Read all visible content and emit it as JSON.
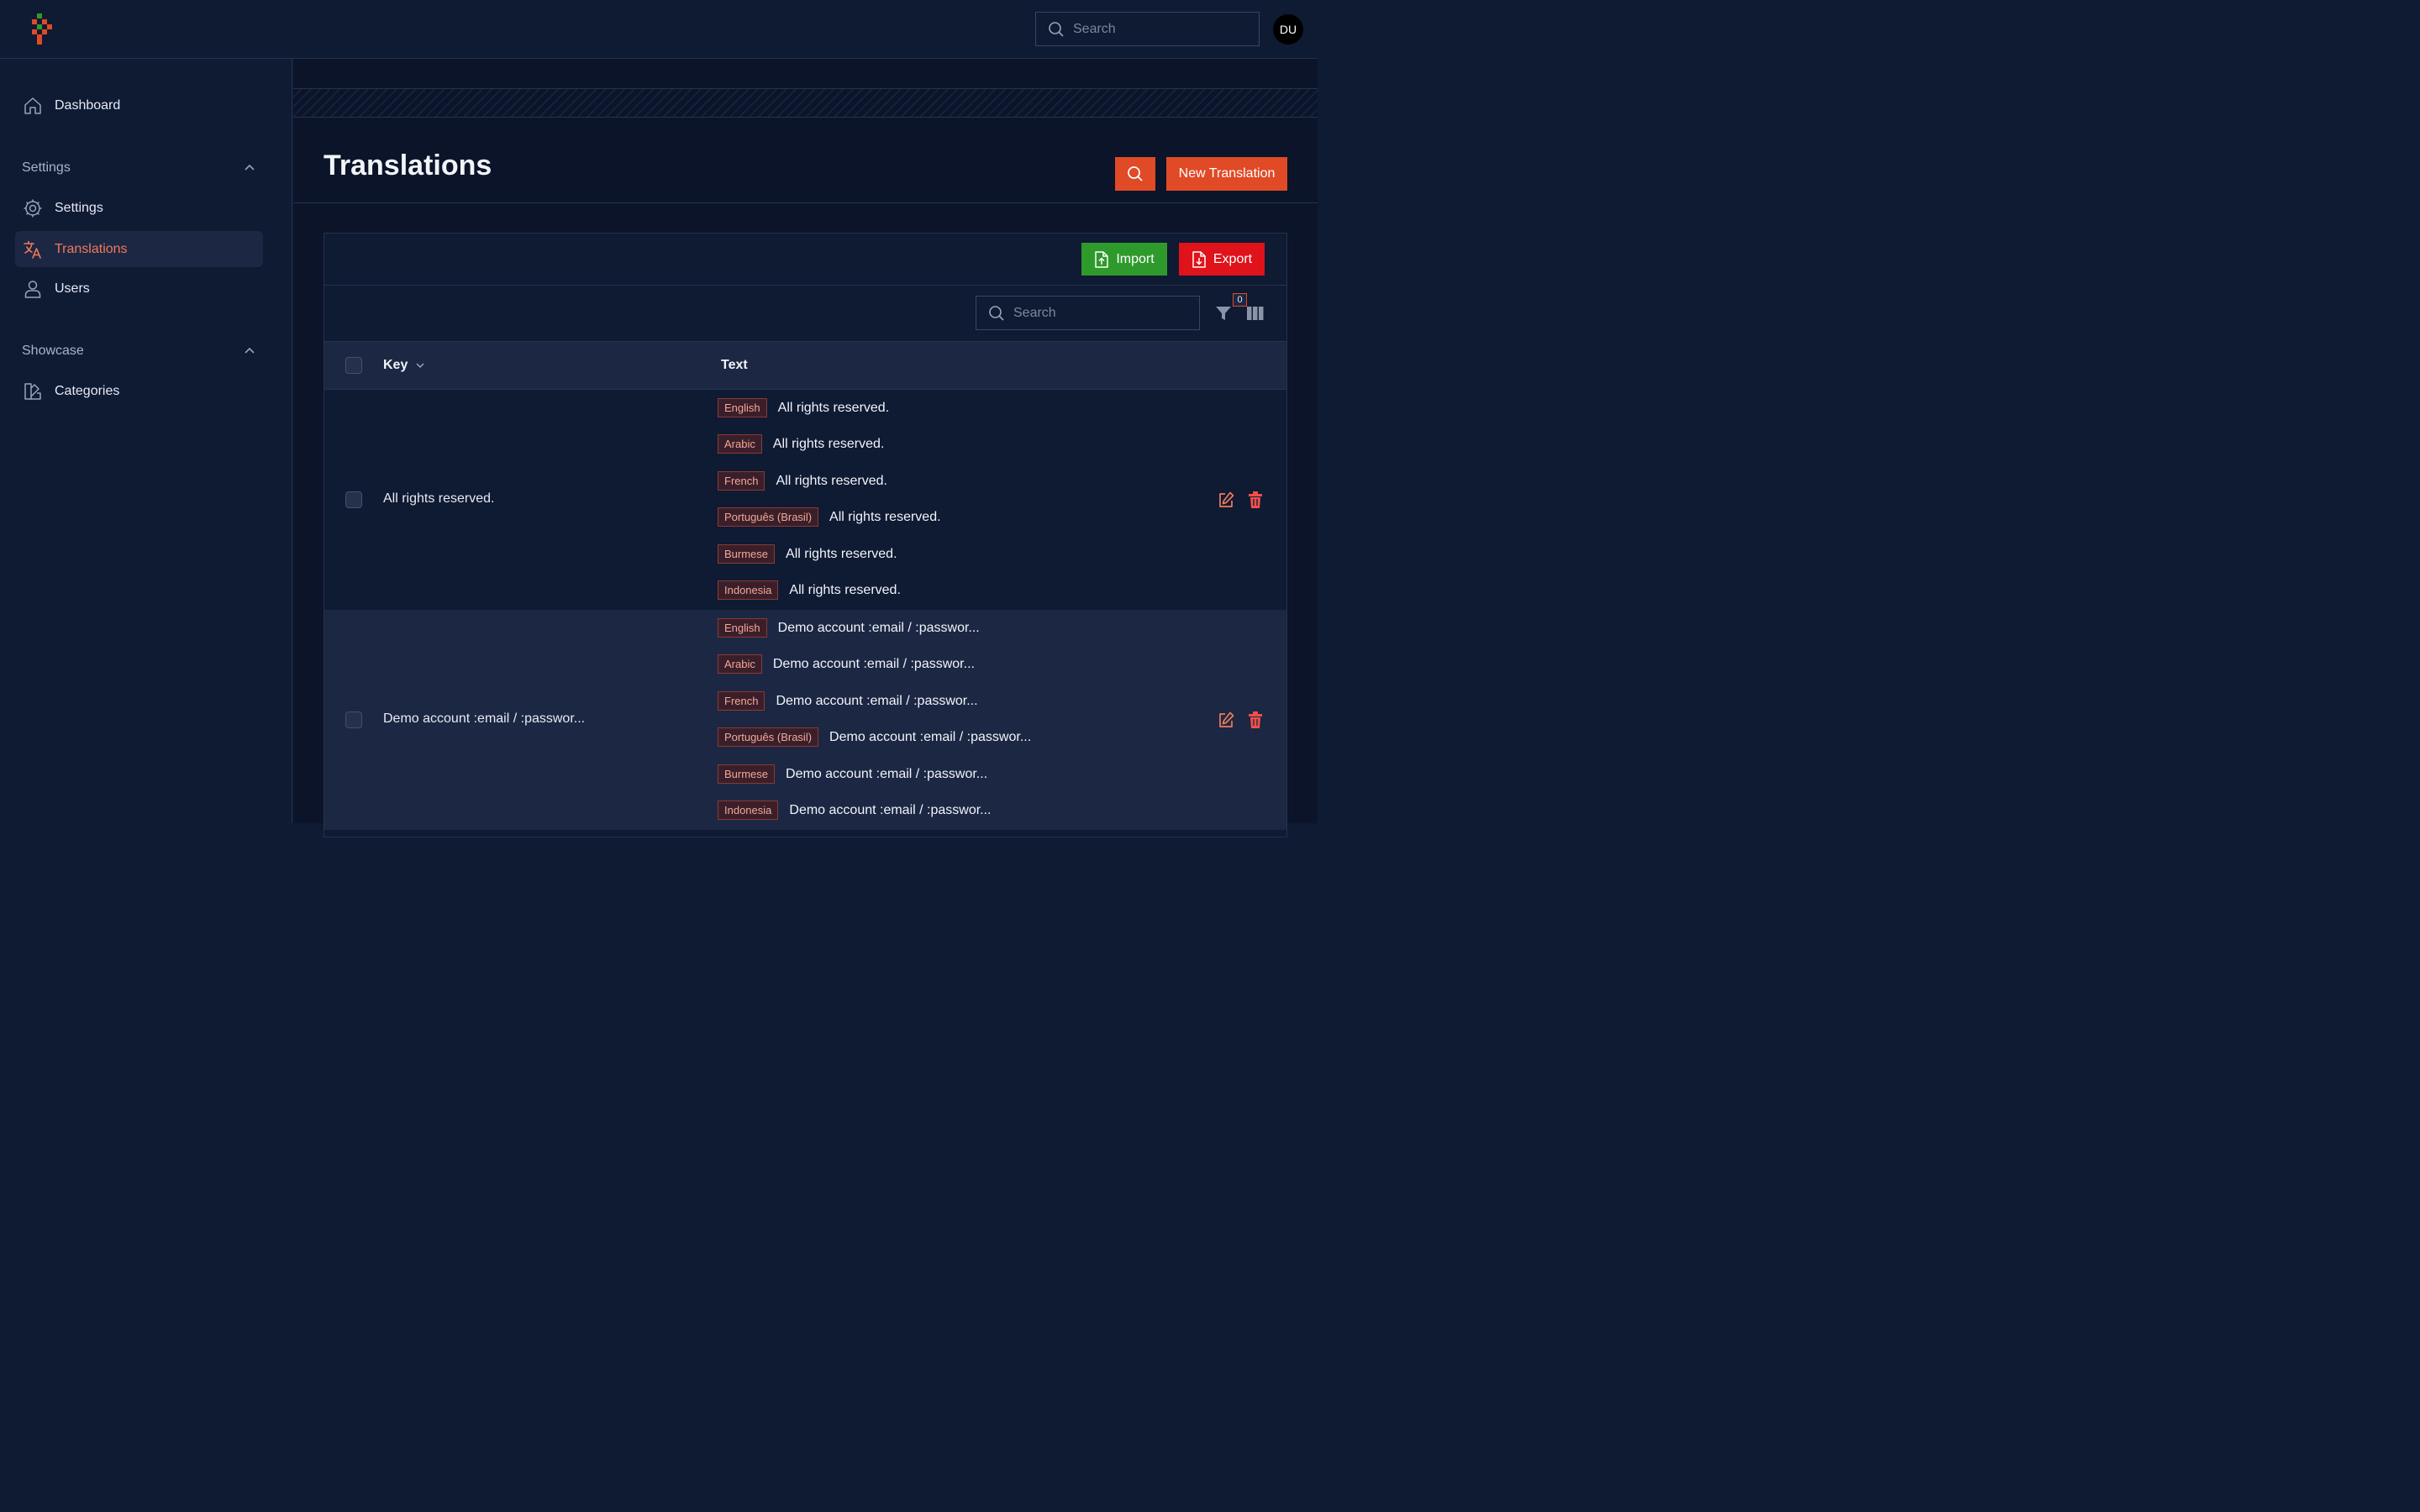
{
  "top": {
    "search_placeholder": "Search",
    "avatar_initials": "DU"
  },
  "sidebar": {
    "dashboard": "Dashboard",
    "settings_group": "Settings",
    "settings": "Settings",
    "translations": "Translations",
    "users": "Users",
    "showcase_group": "Showcase",
    "categories": "Categories"
  },
  "page": {
    "title": "Translations",
    "new_button": "New Translation"
  },
  "panel": {
    "import_label": "Import",
    "export_label": "Export",
    "search_placeholder": "Search",
    "filter_count": "0"
  },
  "table": {
    "col_key": "Key",
    "col_text": "Text",
    "rows": [
      {
        "key": "All rights reserved.",
        "translations": [
          {
            "lang": "English",
            "text": "All rights reserved."
          },
          {
            "lang": "Arabic",
            "text": "All rights reserved."
          },
          {
            "lang": "French",
            "text": "All rights reserved."
          },
          {
            "lang": "Português (Brasil)",
            "text": "All rights reserved."
          },
          {
            "lang": "Burmese",
            "text": "All rights reserved."
          },
          {
            "lang": "Indonesia",
            "text": "All rights reserved."
          }
        ]
      },
      {
        "key": "Demo account :email / :passwor...",
        "translations": [
          {
            "lang": "English",
            "text": "Demo account :email / :passwor..."
          },
          {
            "lang": "Arabic",
            "text": "Demo account :email / :passwor..."
          },
          {
            "lang": "French",
            "text": "Demo account :email / :passwor..."
          },
          {
            "lang": "Português (Brasil)",
            "text": "Demo account :email / :passwor..."
          },
          {
            "lang": "Burmese",
            "text": "Demo account :email / :passwor..."
          },
          {
            "lang": "Indonesia",
            "text": "Demo account :email / :passwor..."
          }
        ]
      }
    ]
  },
  "colors": {
    "accent": "#e04a26",
    "import": "#2f9a2c",
    "export": "#e0121a",
    "active_nav": "#f07a5c"
  }
}
